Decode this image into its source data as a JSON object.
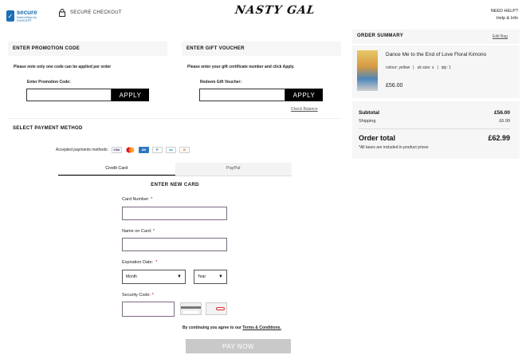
{
  "header": {
    "norton_title": "secure",
    "norton_sub": "NortonSign by DIGICERT",
    "secure_checkout": "SECURE CHECKOUT",
    "logo": "NASTY GAL",
    "need_help": "NEED HELP?",
    "help_info": "Help & Info"
  },
  "promo": {
    "heading": "ENTER PROMOTION CODE",
    "note": "Please note only one code can be applied per order",
    "label": "Enter Promotion Code:",
    "value": "",
    "apply": "APPLY"
  },
  "voucher": {
    "heading": "ENTER GIFT VOUCHER",
    "note": "Please enter your gift certificate number and click Apply.",
    "label": "Redeem Gift Voucher:",
    "value": "",
    "apply": "APPLY",
    "check_balance": "Check Balance"
  },
  "payment": {
    "heading": "SELECT PAYMENT METHOD",
    "accepted_label": "Accepted payments methods:",
    "card_logos": [
      "visa",
      "mastercard",
      "amex",
      "paypal",
      "maestro",
      "discover"
    ],
    "tabs": [
      {
        "label": "Credit Card",
        "active": true
      },
      {
        "label": "PayPal",
        "active": false
      }
    ],
    "enter_new_card": "ENTER NEW CARD",
    "card_number_label": "Card Number:",
    "name_on_card_label": "Name on Card:",
    "expiration_label": "Expiration Date:",
    "month": "Month",
    "year": "Year",
    "security_label": "Security Code:",
    "required_mark": "*",
    "terms_text": "By continuing you agree to our ",
    "terms_link": "Terms & Conditions.",
    "pay_now": "PAY NOW"
  },
  "summary": {
    "heading": "ORDER SUMMARY",
    "edit_bag": "Edit Bag",
    "product": {
      "name": "Dance Me to the End of Love Floral Kimono",
      "colour": "colour: yellow",
      "size": "uk size: s",
      "qty": "qty: 1",
      "price": "£56.00"
    },
    "subtotal_label": "Subtotal",
    "subtotal_value": "£56.00",
    "shipping_label": "Shipping",
    "shipping_value": "£6.99",
    "total_label": "Order total",
    "total_value": "£62.99",
    "tax_note": "*All taxes are included in product prices"
  }
}
